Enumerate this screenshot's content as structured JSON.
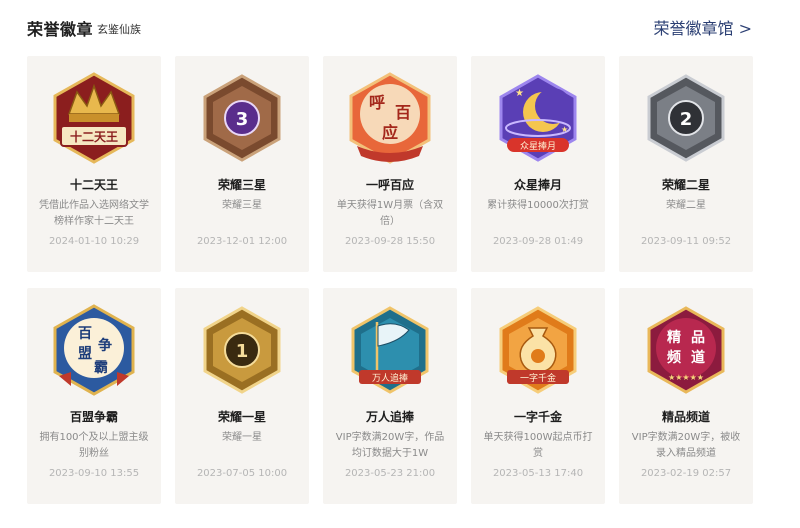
{
  "header": {
    "title": "荣誉徽章",
    "subtitle": "玄鉴仙族",
    "hall_link": "荣誉徽章馆 >"
  },
  "badges": [
    {
      "name": "十二天王",
      "desc": "凭借此作品入选网络文学榜样作家十二天王",
      "date": "2024-01-10 10:29",
      "icon": "twelve-kings-crown-icon",
      "color": "#c0392b"
    },
    {
      "name": "荣耀三星",
      "desc": "荣耀三星",
      "date": "2023-12-01 12:00",
      "icon": "three-star-honor-icon",
      "color": "#7a4a2e"
    },
    {
      "name": "一呼百应",
      "desc": "单天获得1W月票（含双倍）",
      "date": "2023-09-28 15:50",
      "icon": "rally-call-icon",
      "color": "#d9542a"
    },
    {
      "name": "众星捧月",
      "desc": "累计获得10000次打赏",
      "date": "2023-09-28 01:49",
      "icon": "moon-stars-icon",
      "color": "#6b4fc7"
    },
    {
      "name": "荣耀二星",
      "desc": "荣耀二星",
      "date": "2023-09-11 09:52",
      "icon": "two-star-honor-icon",
      "color": "#5d6066"
    },
    {
      "name": "百盟争霸",
      "desc": "拥有100个及以上盟主级别粉丝",
      "date": "2023-09-10 13:55",
      "icon": "hundred-alliance-icon",
      "color": "#2c5aa0"
    },
    {
      "name": "荣耀一星",
      "desc": "荣耀一星",
      "date": "2023-07-05 10:00",
      "icon": "one-star-honor-icon",
      "color": "#b88a2e"
    },
    {
      "name": "万人追捧",
      "desc": "VIP字数满20W字，作品均订数据大于1W",
      "date": "2023-05-23 21:00",
      "icon": "flag-crowd-icon",
      "color": "#1f6f8b"
    },
    {
      "name": "一字千金",
      "desc": "单天获得100W起点币打赏",
      "date": "2023-05-13 17:40",
      "icon": "money-bag-icon",
      "color": "#e07b1a"
    },
    {
      "name": "精品频道",
      "desc": "VIP字数满20W字，被收录入精品频道",
      "date": "2023-02-19 02:57",
      "icon": "premium-channel-icon",
      "color": "#a6224a"
    }
  ]
}
